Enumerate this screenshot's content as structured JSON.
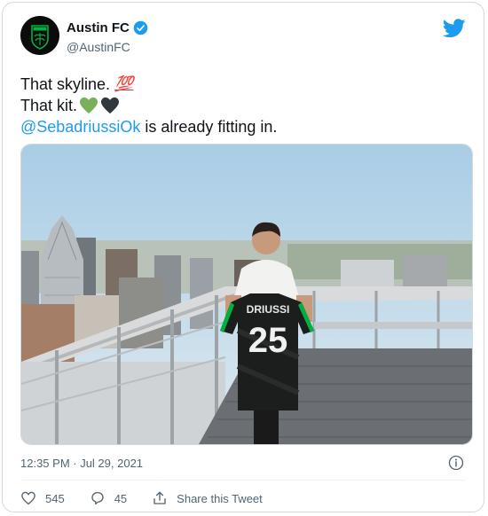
{
  "account": {
    "display_name": "Austin FC",
    "handle": "@AustinFC",
    "verified": true
  },
  "tweet": {
    "line1_text": "That skyline.",
    "line1_emoji": "💯",
    "line2_text": "That kit.",
    "line2_emojis": [
      "💚",
      "🖤"
    ],
    "mention": "@SebadriussiOk",
    "line3_rest": " is already fitting in.",
    "timestamp": "12:35 PM · Jul 29, 2021"
  },
  "jersey": {
    "name": "DRIUSSI",
    "number": "25"
  },
  "actions": {
    "like_count": "545",
    "reply_count": "45",
    "share_label": "Share this Tweet"
  },
  "colors": {
    "link": "#1d9bf0",
    "verified": "#1d9bf0",
    "twitter_bird": "#1d9bf0",
    "austin_green": "#00b140",
    "text_primary": "#0f1419",
    "text_secondary": "#536471"
  },
  "icons": {
    "bird": "twitter-bird-icon",
    "verified": "verified-badge-icon",
    "info": "info-icon",
    "like": "heart-icon",
    "reply": "reply-bubble-icon",
    "share": "share-icon"
  }
}
